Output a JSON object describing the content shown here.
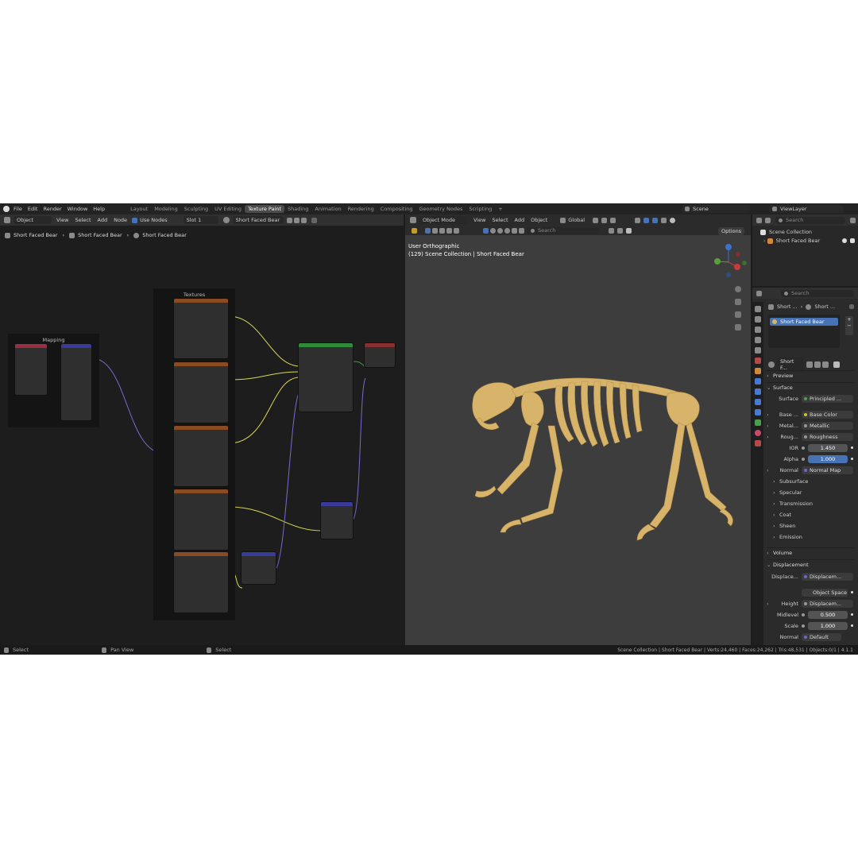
{
  "menus": [
    "File",
    "Edit",
    "Render",
    "Window",
    "Help"
  ],
  "workspaces": [
    "Layout",
    "Modeling",
    "Sculpting",
    "UV Editing",
    "Texture Paint",
    "Shading",
    "Animation",
    "Rendering",
    "Compositing",
    "Geometry Nodes",
    "Scripting"
  ],
  "active_workspace": "Texture Paint",
  "scene": "Scene",
  "view_layer": "ViewLayer",
  "node_editor": {
    "object_type": "Object",
    "menu": [
      "View",
      "Select",
      "Add",
      "Node"
    ],
    "use_nodes": "Use Nodes",
    "slot": "Slot 1",
    "material": "Short Faced Bear",
    "breadcrumb": [
      "Short Faced Bear",
      "Short Faced Bear",
      "Short Faced Bear"
    ],
    "frames": {
      "mapping": "Mapping",
      "textures": "Textures"
    }
  },
  "viewport": {
    "mode": "Object Mode",
    "menu": [
      "View",
      "Select",
      "Add",
      "Object"
    ],
    "orientation": "Global",
    "search_placeholder": "Search",
    "options": "Options",
    "view_name": "User Orthographic",
    "view_context": "(129) Scene Collection | Short Faced Bear"
  },
  "outliner": {
    "search_placeholder": "Search",
    "collection": "Scene Collection",
    "object": "Short Faced Bear"
  },
  "properties": {
    "search_placeholder": "Search",
    "crumb": [
      "Short ...",
      "Short ..."
    ],
    "material_slot": "Short Faced Bear",
    "material_name": "Short F...",
    "preview": "Preview",
    "surface_header": "Surface",
    "rows": [
      {
        "label": "Surface",
        "value": "Principled ..."
      },
      {
        "label": "Base ...",
        "value": "Base Color"
      },
      {
        "label": "Metal...",
        "value": "Metallic"
      },
      {
        "label": "Roug...",
        "value": "Roughness"
      }
    ],
    "ior": {
      "label": "IOR",
      "value": "1.450"
    },
    "alpha": {
      "label": "Alpha",
      "value": "1.000"
    },
    "normal": {
      "label": "Normal",
      "value": "Normal Map"
    },
    "subsections": [
      "Subsurface",
      "Specular",
      "Transmission",
      "Coat",
      "Sheen",
      "Emission"
    ],
    "volume": "Volume",
    "displacement_header": "Displacement",
    "displacement": {
      "label": "Displace...",
      "value": "Displacem..."
    },
    "space": "Object Space",
    "height": {
      "label": "Height",
      "value": "Displacem..."
    },
    "midlevel": {
      "label": "Midlevel",
      "value": "0.500"
    },
    "scale": {
      "label": "Scale",
      "value": "1.000"
    },
    "normal2": {
      "label": "Normal",
      "value": "Default"
    }
  },
  "status": {
    "left1": "Select",
    "left2": "Pan View",
    "left3": "Select",
    "right": "Scene Collection | Short Faced Bear | Verts:24,460 | Faces:24,262 | Tris:48,531 | Objects:0/1 | 4.1.1"
  },
  "colors": {
    "accent": "#4772b3",
    "texture_header": "#8a4a22",
    "shader_header": "#2f8a3a",
    "output_header": "#8a2f2f",
    "vector_header": "#3a3a9a",
    "bone": "#d8b46a"
  }
}
